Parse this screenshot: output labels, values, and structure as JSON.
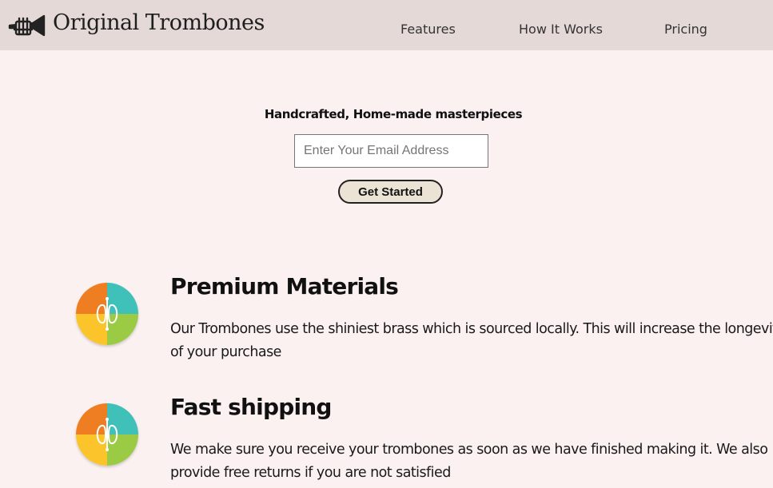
{
  "header": {
    "brand": "Original Trombones",
    "logo_icon": "trumpet-icon",
    "nav": [
      {
        "label": "Features"
      },
      {
        "label": "How It Works"
      },
      {
        "label": "Pricing"
      }
    ]
  },
  "hero": {
    "heading": "Handcrafted, Home-made masterpieces",
    "email_placeholder": "Enter Your Email Address",
    "email_value": "",
    "cta_label": "Get Started"
  },
  "features": [
    {
      "icon": "colorful-quadrant-logo-icon",
      "title": "Premium Materials",
      "description": "Our Trombones use the shiniest brass which is sourced locally. This will increase the longevity of your purchase"
    },
    {
      "icon": "colorful-quadrant-logo-icon",
      "title": "Fast shipping",
      "description": "We make sure you receive your trombones as soon as we have finished making it. We also provide free returns if you are not satisfied"
    }
  ],
  "colors": {
    "page_bg": "#fbf1f1",
    "header_bg": "#e5d9d8",
    "button_bg": "#ebe3d4",
    "icon_orange": "#ef7d22",
    "icon_teal": "#3fc0b9",
    "icon_yellow": "#fcc42b",
    "icon_green": "#9bcb44"
  }
}
